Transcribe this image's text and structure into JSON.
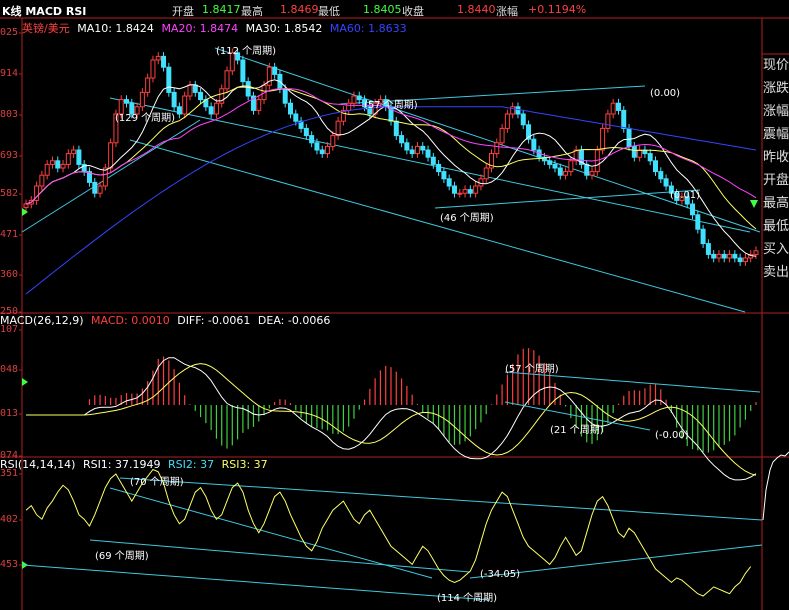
{
  "header": {
    "title": "K线 MACD RSI",
    "open_label": "开盘",
    "open_value": "1.8417",
    "high_label": "最高",
    "high_value": "1.8469",
    "low_label": "最低",
    "low_value": "1.8405",
    "close_label": "收盘",
    "close_value": "1.8440",
    "change_label": "涨幅",
    "change_value": "+0.1194%"
  },
  "price_pane": {
    "symbol": "英镑/美元",
    "ma10": "MA10: 1.8424",
    "ma20": "MA20: 1.8474",
    "ma30": "MA30: 1.8542",
    "ma60": "MA60: 1.8633",
    "yticks": [
      "025",
      "914",
      "803",
      "693",
      "582",
      "471",
      "360",
      "250"
    ]
  },
  "macd_pane": {
    "label": "MACD(26,12,9)",
    "macd": "MACD: 0.0010",
    "diff": "DIFF: -0.0061",
    "dea": "DEA: -0.0066",
    "yticks": [
      "107",
      "048",
      "013",
      "074"
    ]
  },
  "rsi_pane": {
    "label": "RSI(14,14,14)",
    "rsi1": "RSI1: 37.1949",
    "rsi2": "RSI2: 37",
    "rsi3": "RSI3: 37",
    "yticks": [
      "351",
      "402",
      "453"
    ]
  },
  "annotations": {
    "a112": "(112 个周期)",
    "a129": "(129 个周期)",
    "a57": "(57 个周期)",
    "a46": "(46 个周期)",
    "a000": "(0.00)",
    "a001": "(0.01)",
    "m57": "(57 个周期)",
    "m21": "(21 个周期)",
    "m000": "(-0.00)",
    "r70": "(70 个周期)",
    "r69": "(69 个周期)",
    "r3405": "(-34.05)",
    "r114": "(114 个周期)"
  },
  "sidebar": {
    "items": [
      "现价",
      "涨跌",
      "涨幅",
      "震幅",
      "昨收",
      "开盘",
      "最高",
      "最低",
      "买入",
      "卖出"
    ]
  },
  "colors": {
    "ma10": "#ffffff",
    "ma20": "#ffff66",
    "ma30": "#ff44ff",
    "ma60": "#3344ff",
    "up": "#40e0ff",
    "down": "#ff4040",
    "trend": "#40c8e0",
    "grid": "#b02020"
  },
  "chart_data": [
    {
      "type": "candlestick",
      "title": "英镑/美元",
      "y_tick_labels": [
        "025",
        "914",
        "803",
        "693",
        "582",
        "471",
        "360",
        "250"
      ],
      "ylim": [
        0.25,
        1.025
      ],
      "series": [
        {
          "name": "MA10",
          "value": 1.8424
        },
        {
          "name": "MA20",
          "value": 1.8474
        },
        {
          "name": "MA30",
          "value": 1.8542
        },
        {
          "name": "MA60",
          "value": 1.8633
        }
      ],
      "close": [
        0.55,
        0.56,
        0.6,
        0.63,
        0.66,
        0.67,
        0.65,
        0.66,
        0.69,
        0.7,
        0.66,
        0.64,
        0.61,
        0.58,
        0.6,
        0.65,
        0.72,
        0.8,
        0.84,
        0.83,
        0.8,
        0.82,
        0.86,
        0.9,
        0.95,
        0.96,
        0.93,
        0.86,
        0.82,
        0.8,
        0.85,
        0.88,
        0.86,
        0.84,
        0.82,
        0.8,
        0.83,
        0.87,
        0.92,
        0.97,
        0.95,
        0.89,
        0.85,
        0.81,
        0.84,
        0.88,
        0.93,
        0.91,
        0.87,
        0.83,
        0.8,
        0.78,
        0.76,
        0.74,
        0.72,
        0.7,
        0.69,
        0.71,
        0.74,
        0.78,
        0.81,
        0.83,
        0.85,
        0.84,
        0.82,
        0.8,
        0.83,
        0.84,
        0.82,
        0.78,
        0.74,
        0.72,
        0.7,
        0.69,
        0.71,
        0.7,
        0.68,
        0.66,
        0.64,
        0.62,
        0.6,
        0.58,
        0.58,
        0.59,
        0.58,
        0.6,
        0.62,
        0.65,
        0.69,
        0.72,
        0.76,
        0.8,
        0.82,
        0.8,
        0.77,
        0.73,
        0.7,
        0.68,
        0.67,
        0.66,
        0.65,
        0.63,
        0.64,
        0.67,
        0.7,
        0.66,
        0.63,
        0.64,
        0.7,
        0.76,
        0.8,
        0.83,
        0.81,
        0.76,
        0.71,
        0.68,
        0.7,
        0.69,
        0.67,
        0.64,
        0.62,
        0.6,
        0.58,
        0.56,
        0.57,
        0.55,
        0.52,
        0.48,
        0.44,
        0.41,
        0.4,
        0.41,
        0.4,
        0.41,
        0.4,
        0.39,
        0.4,
        0.41,
        0.42
      ]
    },
    {
      "type": "bar",
      "title": "MACD(26,12,9)",
      "y_tick_labels": [
        "107",
        "048",
        "013",
        "074"
      ],
      "series": [
        {
          "name": "MACD",
          "value": 0.001
        },
        {
          "name": "DIFF",
          "value": -0.0061
        },
        {
          "name": "DEA",
          "value": -0.0066
        }
      ]
    },
    {
      "type": "line",
      "title": "RSI(14,14,14)",
      "y_tick_labels": [
        "351",
        "402",
        "453"
      ],
      "series": [
        {
          "name": "RSI1",
          "value": 37.1949
        },
        {
          "name": "RSI2",
          "value": 37
        },
        {
          "name": "RSI3",
          "value": 37
        }
      ],
      "rsi": [
        62,
        64,
        60,
        58,
        63,
        66,
        70,
        73,
        71,
        66,
        60,
        58,
        55,
        60,
        66,
        72,
        76,
        78,
        74,
        70,
        66,
        70,
        74,
        77,
        80,
        79,
        74,
        66,
        60,
        56,
        58,
        64,
        70,
        72,
        68,
        62,
        58,
        60,
        66,
        72,
        74,
        70,
        62,
        56,
        52,
        56,
        62,
        68,
        70,
        66,
        60,
        55,
        50,
        46,
        44,
        48,
        54,
        58,
        62,
        64,
        66,
        62,
        58,
        56,
        60,
        62,
        58,
        54,
        50,
        46,
        44,
        42,
        40,
        38,
        42,
        46,
        44,
        40,
        36,
        33,
        31,
        30,
        31,
        33,
        35,
        40,
        48,
        56,
        62,
        66,
        70,
        68,
        62,
        56,
        50,
        46,
        44,
        42,
        40,
        38,
        41,
        46,
        50,
        46,
        42,
        44,
        52,
        60,
        66,
        68,
        64,
        58,
        52,
        50,
        54,
        52,
        48,
        44,
        40,
        36,
        34,
        32,
        30,
        32,
        31,
        29,
        27,
        25,
        24,
        26,
        28,
        27,
        26,
        25,
        28,
        30,
        34,
        37
      ]
    }
  ]
}
